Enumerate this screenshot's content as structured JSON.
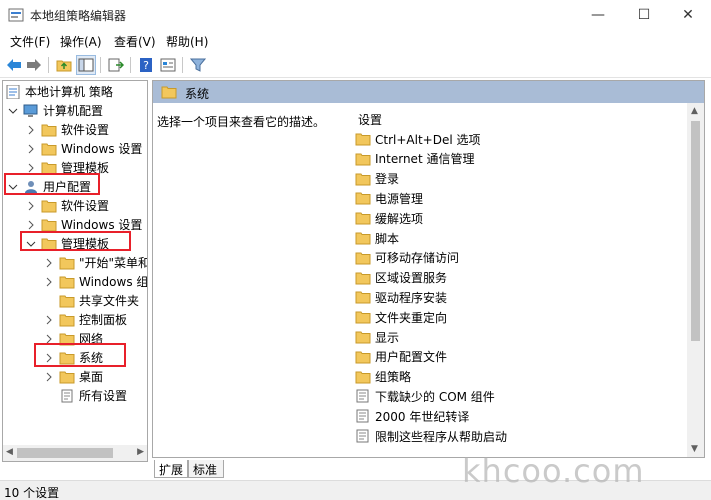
{
  "window": {
    "title": "本地组策略编辑器",
    "minimize_glyph": "—",
    "maximize_glyph": "☐",
    "close_glyph": "✕"
  },
  "menu": [
    "文件(F)",
    "操作(A)",
    "查看(V)",
    "帮助(H)"
  ],
  "tree": {
    "root": "本地计算机 策略",
    "computer_config": "计算机配置",
    "computer_children": [
      "软件设置",
      "Windows 设置",
      "管理模板"
    ],
    "user_config": "用户配置",
    "user_children": [
      "软件设置",
      "Windows 设置",
      "管理模板"
    ],
    "admin_templates_children": [
      "\"开始\"菜单和",
      "Windows 组",
      "共享文件夹",
      "控制面板",
      "网络",
      "系统",
      "桌面",
      "所有设置"
    ]
  },
  "content": {
    "header_title": "系统",
    "description": "选择一个项目来查看它的描述。",
    "column_header": "设置",
    "items": [
      {
        "label": "Ctrl+Alt+Del 选项",
        "type": "folder"
      },
      {
        "label": "Internet 通信管理",
        "type": "folder"
      },
      {
        "label": "登录",
        "type": "folder"
      },
      {
        "label": "电源管理",
        "type": "folder"
      },
      {
        "label": "缓解选项",
        "type": "folder"
      },
      {
        "label": "脚本",
        "type": "folder"
      },
      {
        "label": "可移动存储访问",
        "type": "folder"
      },
      {
        "label": "区域设置服务",
        "type": "folder"
      },
      {
        "label": "驱动程序安装",
        "type": "folder"
      },
      {
        "label": "文件夹重定向",
        "type": "folder"
      },
      {
        "label": "显示",
        "type": "folder"
      },
      {
        "label": "用户配置文件",
        "type": "folder"
      },
      {
        "label": "组策略",
        "type": "folder"
      },
      {
        "label": "下载缺少的 COM 组件",
        "type": "setting"
      },
      {
        "label": "2000 年世纪转译",
        "type": "setting"
      },
      {
        "label": "限制这些程序从帮助启动",
        "type": "setting"
      }
    ]
  },
  "tabs": [
    "扩展",
    "标准"
  ],
  "status": "10 个设置",
  "watermark": "khcoo.com",
  "colors": {
    "header_bg": "#a9bcd6",
    "folder": "#f2c75c",
    "highlight_box": "#e8202a"
  }
}
